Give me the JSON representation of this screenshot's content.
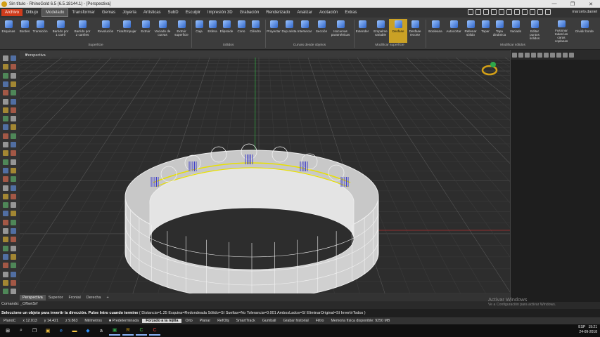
{
  "window": {
    "title": "Sin título - RhinoGold 6.5 (6.5.18144.1) - [Perspectiva]",
    "minimize": "—",
    "maximize": "❐",
    "close": "✕"
  },
  "menu": [
    "Archivo",
    "Dibujo",
    "Modelado",
    "Transformar",
    "Gemas",
    "Joyería",
    "Artísticas",
    "SubD",
    "Esculpir",
    "Impresión 3D",
    "Grabación",
    "Renderizado",
    "Analizar",
    "Acotación",
    "Extras"
  ],
  "user": "marcelo.daniel",
  "ribbon": {
    "buttons": [
      "Esquinas",
      "Bordes",
      "Transición",
      "Barrido por 1 carril",
      "Barrido por 2 carriles",
      "Revolución",
      "Tirar/Empujar",
      "Extruir",
      "Vaciado de curvas",
      "Extruir superficie",
      "Caja",
      "Esfera",
      "Elipsoide",
      "Cono",
      "Cilindro",
      "Proyectar",
      "Dup arista",
      "Intersecar",
      "Sección",
      "Isocurvas paramétricas",
      "Extender",
      "Empalme variable",
      "Desfase",
      "Desfase recorte",
      "Booleana",
      "Autocortar",
      "Rellenar sólido",
      "Tapar",
      "Tapa dinámica",
      "Vaciado",
      "Editar puntos sólidos",
      "Fusionar todas las caras coplanas",
      "Dividir borde"
    ],
    "groups": [
      "Superficie",
      "Sólidos",
      "Curvas desde objetos",
      "Modificar superficie",
      "Modificar sólidos"
    ]
  },
  "viewport": {
    "name": "Perspectiva",
    "dropdown": "▾"
  },
  "view_tabs": [
    "Perspectiva",
    "Superior",
    "Frontal",
    "Derecha",
    "+"
  ],
  "command_history": "Comando: _OffsetSrf",
  "command_line": {
    "prompt": "Seleccione un objeto para invertir la dirección. Pulse Intro cuando termine",
    "options": "( Distancia=1.25  Esquina=Redondeada  Sólido=Sí  Sueltas=No  Tolerancia=0.001  AmbosLados=Sí  EliminarOriginal=Sí  InvertirTodos )"
  },
  "status": {
    "cplane": "PlanoC",
    "x": "x 12.013",
    "y": "y 14.421",
    "z": "z 9.863",
    "units": "Milímetros",
    "layer": "Predeterminada",
    "snap": "Forzado a la rejilla",
    "ortho": "Orto",
    "planar": "Planar",
    "osnap": "RefObj",
    "smarttrack": "SmartTrack",
    "gumball": "Gumball",
    "history": "Grabar historial",
    "filter": "Filtro",
    "memory": "Memoria física disponible: 9250 MB"
  },
  "watermark": {
    "line1": "Activar Windows",
    "line2": "Ve a Configuración para activar Windows."
  },
  "tray": {
    "lang": "ESP",
    "time": "19:21",
    "date": "24-09-2018"
  },
  "taskbar": [
    "windows-icon",
    "search-icon",
    "task-view-icon",
    "store-icon",
    "edge-icon",
    "explorer-icon",
    "dropbox-icon",
    "amazon-icon",
    "xbox-icon",
    "rhinogold-icon",
    "camtasia-icon",
    "recorder-icon"
  ],
  "colors": {
    "ring": "#eeeeee",
    "selection": "#e8e000",
    "grid": "#3c3c3c",
    "gridMajor": "#555555",
    "axisX": "#b03030",
    "axisY": "#30a040"
  }
}
